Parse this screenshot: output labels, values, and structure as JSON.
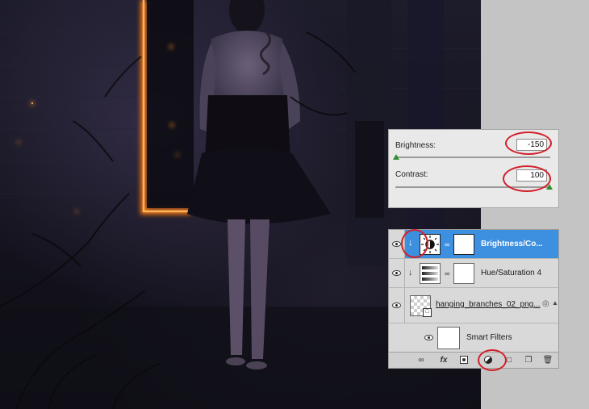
{
  "adjustments": {
    "brightness_label": "Brightness:",
    "brightness_value": "-150",
    "contrast_label": "Contrast:",
    "contrast_value": "100"
  },
  "layers": [
    {
      "name": "Brightness/Co...",
      "selected": true,
      "type": "adjustment"
    },
    {
      "name": "Hue/Saturation 4",
      "selected": false,
      "type": "adjustment"
    },
    {
      "name": "hanging_branches_02_png...",
      "selected": false,
      "type": "smart-object"
    },
    {
      "name": "Smart Filters",
      "selected": false,
      "type": "filter"
    }
  ],
  "footer": {
    "link_icon": "link-layers-icon",
    "fx_label": "fx",
    "mask_icon": "add-mask-icon",
    "adjustment_icon": "new-adjustment-layer-icon",
    "group_icon": "new-group-icon",
    "new_layer_icon": "new-layer-icon",
    "trash_icon": "delete-layer-icon"
  },
  "colors": {
    "selection_blue": "#3d8fe0",
    "annotation_red": "#d1202a",
    "glow_orange": "#ff8a1e",
    "slider_green": "#2f8f2f"
  }
}
